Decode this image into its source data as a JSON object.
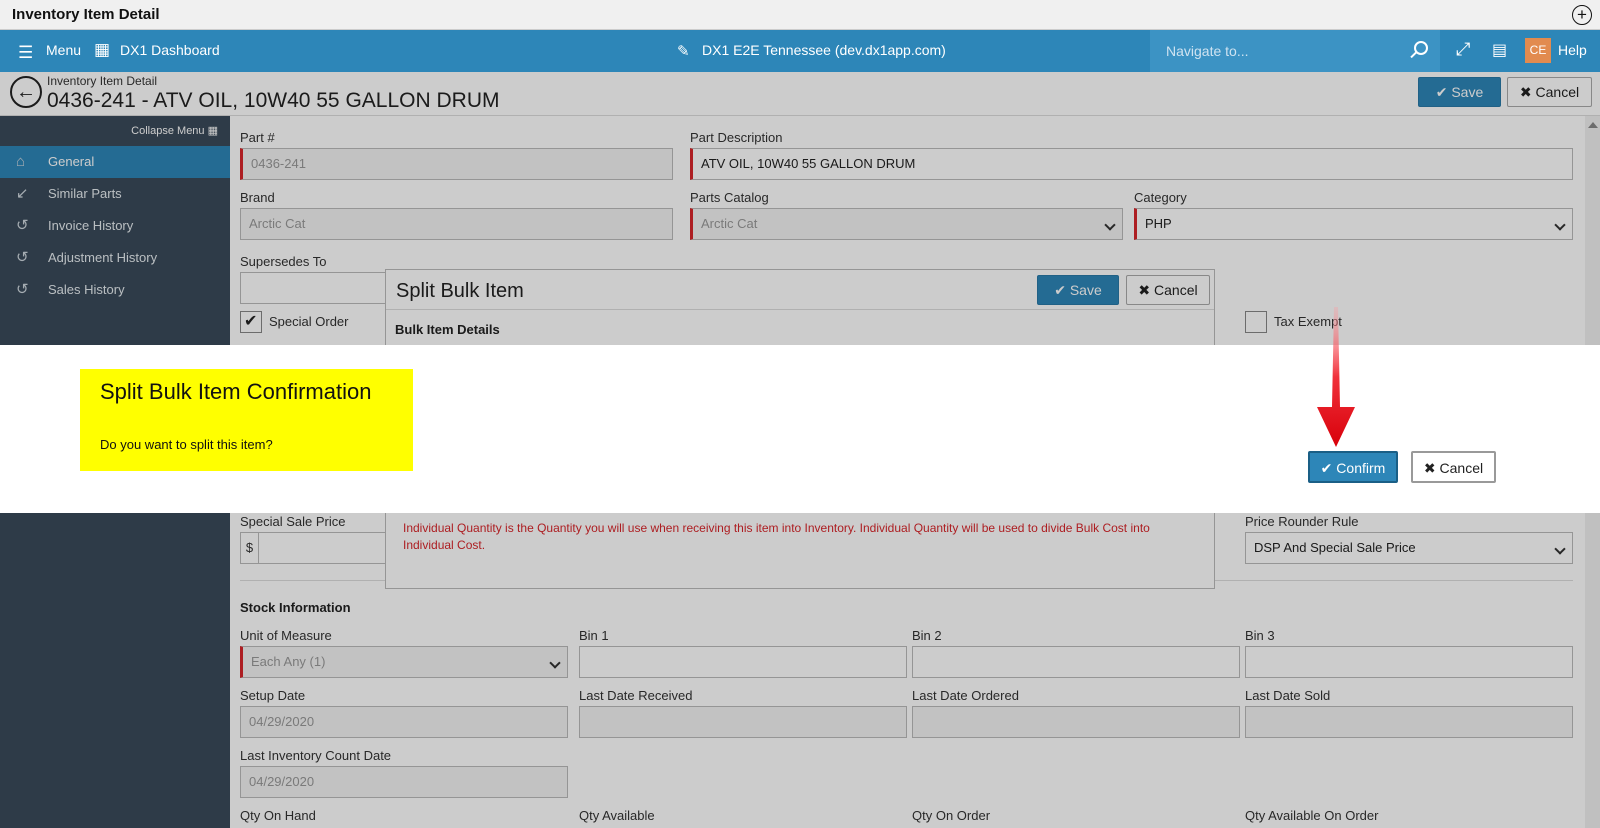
{
  "window": {
    "title": "Inventory Item Detail"
  },
  "topnav": {
    "menu_label": "Menu",
    "dashboard_label": "DX1 Dashboard",
    "site_label": "DX1 E2E Tennessee (dev.dx1app.com)",
    "search_placeholder": "Navigate to...",
    "avatar_initials": "CE",
    "help_label": "Help"
  },
  "header": {
    "breadcrumb": "Inventory Item Detail",
    "title": "0436-241 - ATV OIL, 10W40 55 GALLON DRUM",
    "save_label": "Save",
    "cancel_label": "Cancel"
  },
  "sidebar": {
    "collapse_label": "Collapse Menu",
    "items": [
      {
        "label": "General",
        "icon": "home-icon",
        "active": true
      },
      {
        "label": "Similar Parts",
        "icon": "compress-icon"
      },
      {
        "label": "Invoice History",
        "icon": "history-icon"
      },
      {
        "label": "Adjustment History",
        "icon": "history-icon"
      },
      {
        "label": "Sales History",
        "icon": "history-icon"
      }
    ]
  },
  "form": {
    "part_no_label": "Part #",
    "part_no_value": "0436-241",
    "part_desc_label": "Part Description",
    "part_desc_value": "ATV OIL, 10W40  55 GALLON DRUM",
    "brand_label": "Brand",
    "brand_value": "Arctic Cat",
    "catalog_label": "Parts Catalog",
    "catalog_value": "Arctic Cat",
    "category_label": "Category",
    "category_value": "PHP",
    "supersedes_label": "Supersedes To",
    "special_order_label": "Special Order",
    "tax_exempt_label": "Tax Exempt",
    "special_sale_label": "Special Sale Price",
    "currency_symbol": "$",
    "price_rounder_label": "Price Rounder Rule",
    "price_rounder_value": "DSP And Special Sale Price",
    "stock_section": "Stock Information",
    "uom_label": "Unit of Measure",
    "uom_value": "Each Any (1)",
    "bin1_label": "Bin 1",
    "bin2_label": "Bin 2",
    "bin3_label": "Bin 3",
    "setup_date_label": "Setup Date",
    "setup_date_value": "04/29/2020",
    "last_received_label": "Last Date Received",
    "last_ordered_label": "Last Date Ordered",
    "last_sold_label": "Last Date Sold",
    "last_count_label": "Last Inventory Count Date",
    "last_count_value": "04/29/2020",
    "qty_on_hand_label": "Qty On Hand",
    "qty_available_label": "Qty Available",
    "qty_on_order_label": "Qty On Order",
    "qty_available_on_order_label": "Qty Available On Order"
  },
  "split_modal": {
    "title": "Split Bulk Item",
    "save_label": "Save",
    "cancel_label": "Cancel",
    "section": "Bulk Item Details",
    "warning": "Individual Quantity is the Quantity you will use when receiving this item into Inventory. Individual Quantity will be used to divide Bulk Cost into Individual Cost."
  },
  "confirm_dialog": {
    "title": "Split Bulk Item Confirmation",
    "question": "Do you want to split this item?",
    "confirm_label": "Confirm",
    "cancel_label": "Cancel"
  },
  "colors": {
    "accent": "#2d86b8",
    "sidebar": "#3a4a5a",
    "required": "#d9262b",
    "highlight": "#ffff00",
    "arrow": "#e8101a"
  }
}
